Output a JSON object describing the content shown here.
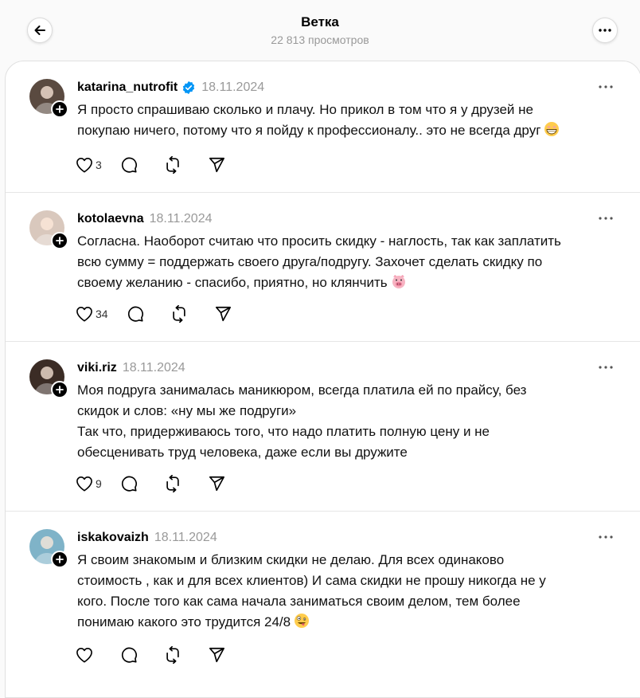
{
  "header": {
    "title": "Ветка",
    "views": "22 813 просмотров"
  },
  "posts": [
    {
      "username": "katarina_nutrofit",
      "verified": true,
      "date": "18.11.2024",
      "lines": [
        "Я просто спрашиваю сколько и плачу. Но прикол в том что я у друзей не",
        "покупаю ничего, потому что я пойду к профессионалу.. это не всегда друг"
      ],
      "emoji": "grinning-face-emoji",
      "likes": "3",
      "avatar_color": "#5a4a40"
    },
    {
      "username": "kotolaevna",
      "verified": false,
      "date": "18.11.2024",
      "lines": [
        "Согласна. Наоборот считаю что просить скидку - наглость, так как заплатить",
        "всю сумму = поддержать своего друга/подругу. Захочет сделать скидку по",
        "своему желанию - спасибо, приятно, но клянчить"
      ],
      "emoji": "pig-face-emoji",
      "likes": "34",
      "avatar_color": "#d9c8bd"
    },
    {
      "username": "viki.riz",
      "verified": false,
      "date": "18.11.2024",
      "lines": [
        "Моя подруга занималась маникюром, всегда платила ей по прайсу, без",
        "скидок и слов: «ну мы же подруги»",
        "Так что, придерживаюсь того, что надо платить полную цену и не",
        "обесценивать труд человека, даже если вы дружите"
      ],
      "emoji": "",
      "likes": "9",
      "avatar_color": "#3b2c25"
    },
    {
      "username": "iskakovaizh",
      "verified": false,
      "date": "18.11.2024",
      "lines": [
        "Я своим знакомым и близким скидки не делаю. Для всех одинаково",
        "стоимость , как и для всех клиентов) И сама скидки не прошу никогда не у",
        "кого. После того как сама начала заниматься своим делом, тем более",
        "понимаю какого это трудится 24/8"
      ],
      "emoji": "zany-face-emoji",
      "likes": "",
      "avatar_color": "#7fb3c8"
    }
  ],
  "colors": {
    "verified_badge": "#0095f6",
    "secondary_text": "#999999"
  }
}
